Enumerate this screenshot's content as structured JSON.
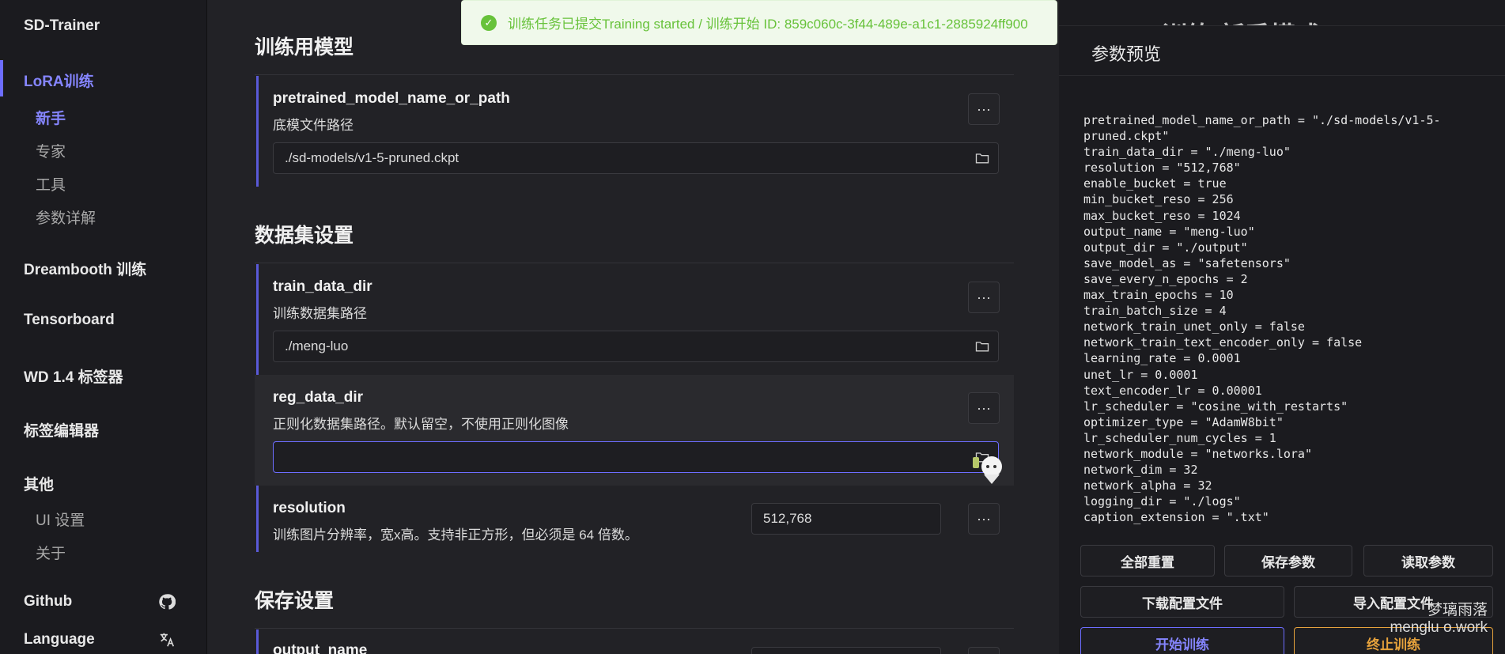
{
  "sidebar": {
    "brand": "SD-Trainer",
    "lora": "LoRA训练",
    "lora_items": [
      "新手",
      "专家",
      "工具",
      "参数详解"
    ],
    "dreambooth": "Dreambooth 训练",
    "tensorboard": "Tensorboard",
    "wd_tagger": "WD 1.4 标签器",
    "tag_editor": "标签编辑器",
    "other": "其他",
    "other_items": [
      "UI 设置",
      "关于"
    ],
    "github": "Github",
    "language": "Language"
  },
  "toast": {
    "message": "训练任务已提交Training started / 训练开始 ID: 859c060c-3f44-489e-a1c1-2885924ff900"
  },
  "main": {
    "section_model": "训练用模型",
    "section_dataset": "数据集设置",
    "section_save": "保存设置",
    "params": {
      "pretrained": {
        "name": "pretrained_model_name_or_path",
        "desc": "底模文件路径",
        "value": "./sd-models/v1-5-pruned.ckpt"
      },
      "train_data_dir": {
        "name": "train_data_dir",
        "desc": "训练数据集路径",
        "value": "./meng-luo"
      },
      "reg_data_dir": {
        "name": "reg_data_dir",
        "desc": "正则化数据集路径。默认留空，不使用正则化图像",
        "value": ""
      },
      "resolution": {
        "name": "resolution",
        "desc": "训练图片分辨率，宽x高。支持非正方形，但必须是 64 倍数。",
        "value": "512,768"
      },
      "output_name": {
        "name": "output_name"
      }
    },
    "more_label": "···"
  },
  "panel": {
    "bg_title": "训练 新手模式",
    "title": "参数预览",
    "code": "pretrained_model_name_or_path = \"./sd-models/v1-5-pruned.ckpt\"\ntrain_data_dir = \"./meng-luo\"\nresolution = \"512,768\"\nenable_bucket = true\nmin_bucket_reso = 256\nmax_bucket_reso = 1024\noutput_name = \"meng-luo\"\noutput_dir = \"./output\"\nsave_model_as = \"safetensors\"\nsave_every_n_epochs = 2\nmax_train_epochs = 10\ntrain_batch_size = 4\nnetwork_train_unet_only = false\nnetwork_train_text_encoder_only = false\nlearning_rate = 0.0001\nunet_lr = 0.0001\ntext_encoder_lr = 0.00001\nlr_scheduler = \"cosine_with_restarts\"\noptimizer_type = \"AdamW8bit\"\nlr_scheduler_num_cycles = 1\nnetwork_module = \"networks.lora\"\nnetwork_dim = 32\nnetwork_alpha = 32\nlogging_dir = \"./logs\"\ncaption_extension = \".txt\"",
    "buttons": {
      "reset": "全部重置",
      "save": "保存参数",
      "load": "读取参数",
      "download": "下载配置文件",
      "import": "导入配置文件",
      "start": "开始训练",
      "stop": "终止训练"
    },
    "watermark_line1": "梦璃雨落",
    "watermark_line2": "menglu o.work"
  },
  "colors": {
    "accent": "#6d6dff",
    "success": "#67c23a",
    "warning": "#e6a23c"
  }
}
